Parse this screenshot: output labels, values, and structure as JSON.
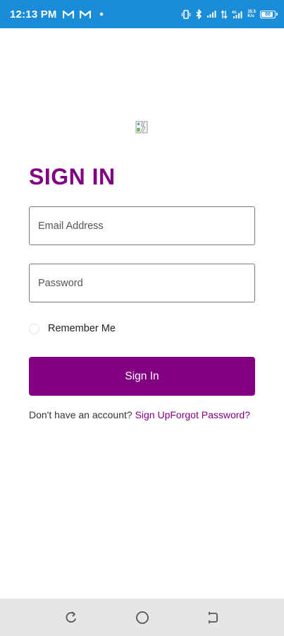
{
  "status_bar": {
    "time": "12:13 PM",
    "battery": "88",
    "network_speed_top": "35.5",
    "network_speed_bottom": "K/s"
  },
  "sign_in": {
    "title": "SIGN IN",
    "email_placeholder": "Email Address",
    "password_placeholder": "Password",
    "remember_label": "Remember Me",
    "remember_checked": false,
    "button_label": "Sign In",
    "no_account_text": "Don't have an account?",
    "sign_up_link": "Sign Up",
    "forgot_password_link": "Forgot Password?"
  },
  "colors": {
    "status_bar": "#1a8cd8",
    "brand": "#800080",
    "nav_bar": "#e6e6e6"
  },
  "icons": {
    "logo": "broken-image-icon",
    "nav_back": "back-icon",
    "nav_home": "home-icon",
    "nav_recent": "recent-apps-icon"
  }
}
